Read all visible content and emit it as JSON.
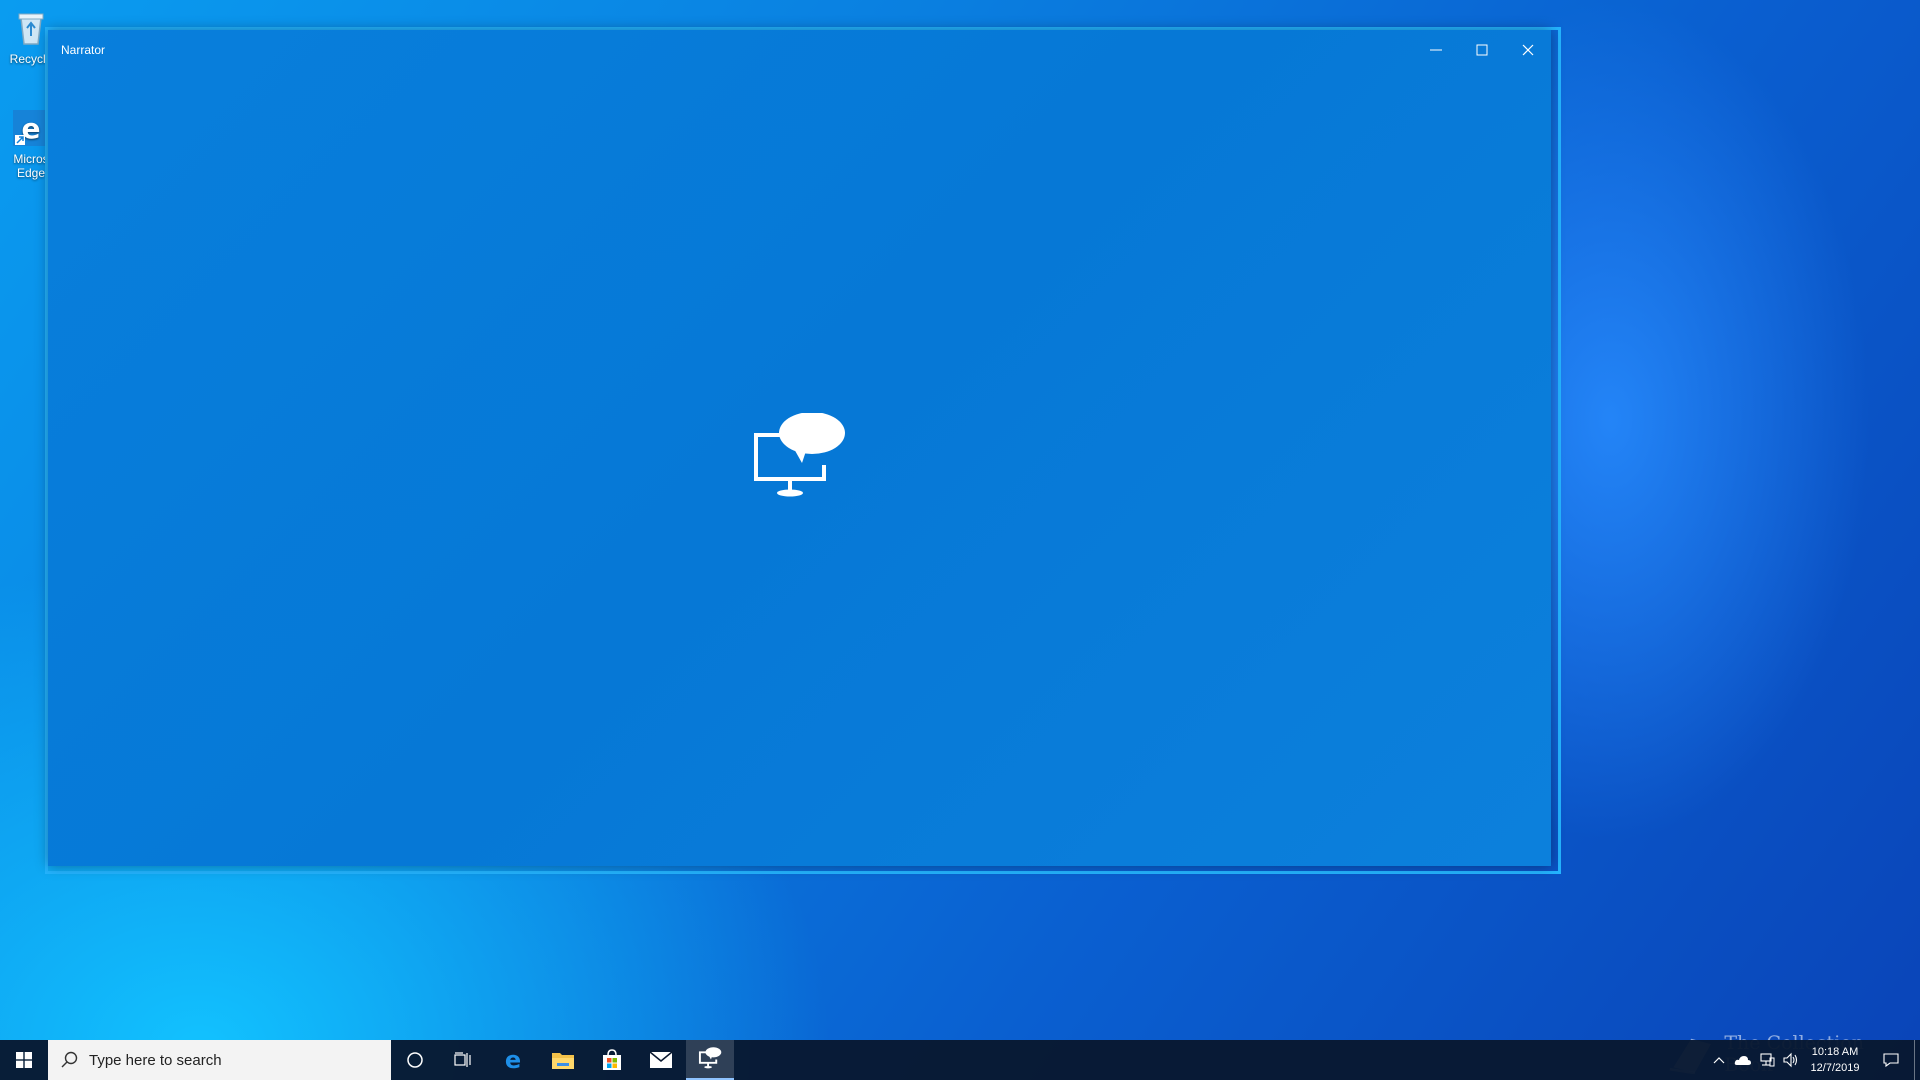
{
  "desktop": {
    "icons": [
      {
        "label": "Recycle",
        "icon": "recycle-bin-icon"
      },
      {
        "label": "Micros Edge",
        "icon": "edge-icon"
      }
    ]
  },
  "window": {
    "title": "Narrator",
    "controls": {
      "minimize": "minimize-icon",
      "maximize": "maximize-icon",
      "close": "close-icon"
    },
    "app_icon": "narrator-icon",
    "accent": "#0678d6"
  },
  "taskbar": {
    "search_placeholder": "Type here to search",
    "pinned": [
      "cortana-icon",
      "task-view-icon",
      "edge-icon",
      "file-explorer-icon",
      "store-icon",
      "mail-icon",
      "narrator-icon"
    ],
    "active_app": "narrator-icon",
    "tray_icons": [
      "show-hidden-icon",
      "onedrive-icon",
      "network-icon",
      "volume-icon",
      "notification-icon"
    ],
    "time": "10:18 AM",
    "date": "12/7/2019"
  },
  "watermark": {
    "text": "The Collection Book"
  }
}
